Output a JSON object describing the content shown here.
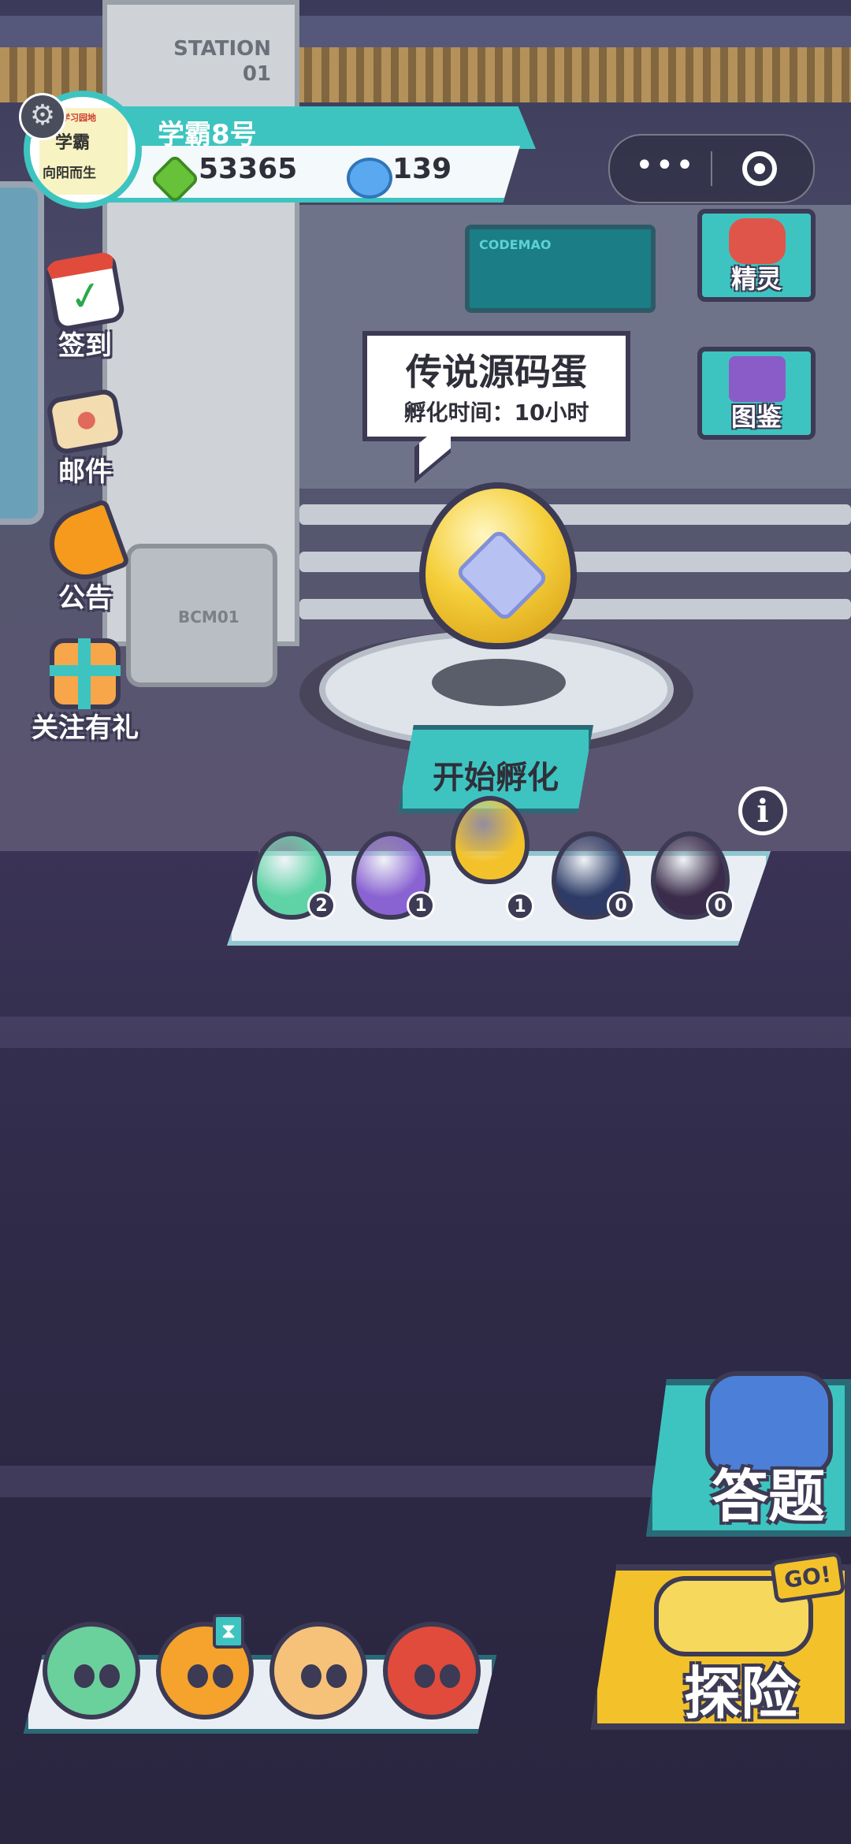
{
  "player": {
    "nickname": "学霸8号",
    "avatar_text_top": "学习园地",
    "avatar_text_mid": "学霸",
    "avatar_text_bottom": "向阳而生",
    "gems": "53365",
    "candies": "139"
  },
  "background": {
    "station_label": "STATION\n01",
    "locker_label": "BCM01",
    "screen_label": "CODEMAO"
  },
  "side_menu": {
    "checkin": "签到",
    "mail": "邮件",
    "notice": "公告",
    "follow_gift": "关注有礼"
  },
  "right_menu": {
    "pets": "精灵",
    "codex": "图鉴"
  },
  "egg_info": {
    "name": "传说源码蛋",
    "hatch_time": "孵化时间：10小时"
  },
  "actions": {
    "start_hatch": "开始孵化",
    "info": "i",
    "answer": "答题",
    "explore": "探险",
    "go_badge": "GO!"
  },
  "egg_tray": [
    {
      "name": "green-egg",
      "count": "2",
      "color": "#5fd3a6"
    },
    {
      "name": "purple-egg",
      "count": "1",
      "color": "#8a63d2"
    },
    {
      "name": "gold-egg",
      "count": "1",
      "color": "#f3c22b"
    },
    {
      "name": "locked-blue-egg",
      "count": "0",
      "color": "#2d3b66"
    },
    {
      "name": "locked-red-egg",
      "count": "0",
      "color": "#3a2c4a"
    }
  ],
  "pets": [
    {
      "name": "green-dino-pet",
      "color": "#6ad19c"
    },
    {
      "name": "orange-pet",
      "color": "#f5a32d"
    },
    {
      "name": "fox-pet",
      "color": "#f6c27a"
    },
    {
      "name": "penguin-pet",
      "color": "#e04b3b"
    }
  ],
  "colors": {
    "accent_teal": "#3ec4c0",
    "accent_yellow": "#f3c22b",
    "outline": "#3c3a54"
  }
}
